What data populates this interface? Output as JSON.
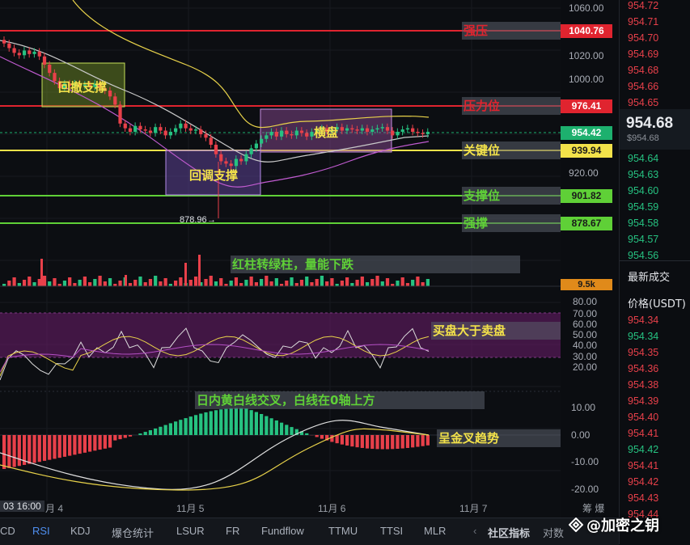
{
  "chart_data": [
    {
      "type": "candlestick",
      "panel": "price",
      "y_ticks": [
        "1060.00",
        "1040.00",
        "1020.00",
        "1000.00",
        "980.00",
        "960.00",
        "940.00",
        "920.00"
      ],
      "ylim": [
        905,
        1066
      ],
      "low_marker": "878.96",
      "levels": [
        {
          "label": "强压",
          "price": "1040.76",
          "value": 1040.76,
          "color": "#e0242f",
          "text_color": "#e0242f"
        },
        {
          "label": "压力位",
          "price": "976.41",
          "value": 976.41,
          "color": "#e0242f",
          "text_color": "#e0242f"
        },
        {
          "label": "",
          "price": "954.42",
          "value": 954.42,
          "color": "#1db06e",
          "text_color": "#ffffff"
        },
        {
          "label": "关键位",
          "price": "939.94",
          "value": 939.94,
          "color": "#f3e24a",
          "text_color": "#f3e24a"
        },
        {
          "label": "支撑位",
          "price": "901.82",
          "value": 901.82,
          "color": "#5fd037",
          "text_color": "#5fd037"
        },
        {
          "label": "强撑",
          "price": "878.67",
          "value": 878.67,
          "color": "#5fd037",
          "text_color": "#5fd037"
        }
      ],
      "boxes": [
        {
          "label": "回撤支撑",
          "color": "#c6e05a"
        },
        {
          "label": "回调支撑",
          "color": "#b58ae6"
        },
        {
          "label": "横盘",
          "color": "#c58de0"
        }
      ],
      "candles_close": [
        1030,
        1026,
        1022,
        1020,
        1024,
        1021,
        1023,
        1019,
        1012,
        1005,
        998,
        992,
        996,
        994,
        996,
        994,
        995,
        993,
        996,
        992,
        990,
        985,
        978,
        962,
        958,
        955,
        960,
        957,
        956,
        954,
        959,
        956,
        952,
        955,
        958,
        962,
        958,
        956,
        957,
        953,
        950,
        944,
        936,
        930,
        928,
        926,
        932,
        930,
        936,
        941,
        945,
        949,
        952,
        955,
        951,
        956,
        953,
        952,
        956,
        954,
        951,
        955,
        957,
        958,
        955,
        957,
        959,
        956,
        958,
        957,
        956,
        958,
        955,
        957,
        958,
        959,
        956,
        952,
        955,
        957,
        958,
        955,
        954,
        953,
        955
      ]
    },
    {
      "type": "bar",
      "panel": "volume",
      "annotation": "红柱转绿柱，量能下跌",
      "value_tag": "9.5k"
    },
    {
      "type": "line",
      "panel": "RSI",
      "y_ticks": [
        "80.00",
        "70.00",
        "60.00",
        "50.00",
        "40.00",
        "30.00",
        "20.00"
      ],
      "ylim": [
        15,
        85
      ],
      "annotation": "买盘大于卖盘"
    },
    {
      "type": "bar",
      "panel": "MACD",
      "y_ticks": [
        "10.00",
        "0.00",
        "-10.00",
        "-20.00"
      ],
      "ylim": [
        -21,
        12
      ],
      "annotation_top": "日内黄白线交叉，白线在0轴上方",
      "annotation_right": "呈金叉趋势"
    }
  ],
  "x_labels": [
    "03 16:00",
    "月 4",
    "11月 5",
    "11月 6",
    "11月 7"
  ],
  "current_price": {
    "value": "954.68",
    "sub": "$954.68"
  },
  "orderbook": {
    "asks": [
      "954.72",
      "954.71",
      "954.70",
      "954.69",
      "954.68",
      "954.66",
      "954.65"
    ],
    "bids": [
      "954.64",
      "954.63",
      "954.60",
      "954.59",
      "954.58",
      "954.57",
      "954.56"
    ],
    "trades_title": "最新成交",
    "price_header": "价格(USDT)",
    "trades": [
      "954.34",
      "954.34",
      "954.35",
      "954.36",
      "954.38",
      "954.39",
      "954.40",
      "954.41",
      "954.42",
      "954.41",
      "954.42",
      "954.43",
      "954.44"
    ]
  },
  "tabs": [
    "CD",
    "RSI",
    "KDJ",
    "爆仓统计",
    "LSUR",
    "FR",
    "Fundflow",
    "TTMU",
    "TTSI",
    "MLR"
  ],
  "community": "社区指标",
  "compare": "对数",
  "extra": "筹 爆",
  "watermark": "@加密之钥"
}
